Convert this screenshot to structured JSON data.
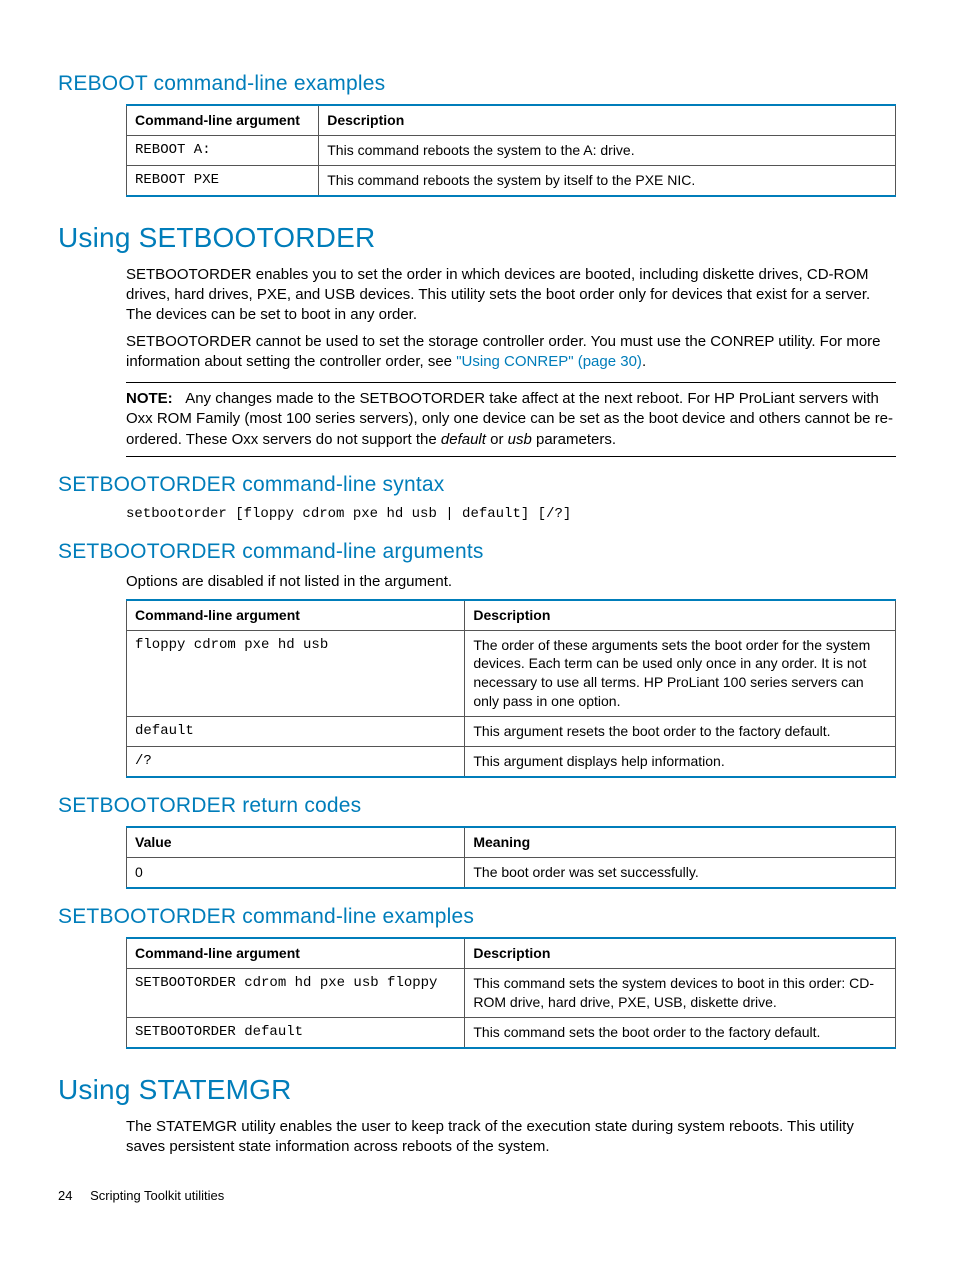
{
  "sections": {
    "reboot_examples_heading": "REBOOT command-line examples",
    "setbootorder_heading": "Using SETBOOTORDER",
    "setbootorder_p1": "SETBOOTORDER enables you to set the order in which devices are booted, including diskette drives, CD-ROM drives, hard drives, PXE, and USB devices. This utility sets the boot order only for devices that exist for a server. The devices can be set to boot in any order.",
    "setbootorder_p2a": "SETBOOTORDER cannot be used to set the storage controller order. You must use the CONREP utility. For more information about setting the controller order, see ",
    "setbootorder_p2_link": "\"Using CONREP\" (page 30)",
    "setbootorder_p2b": ".",
    "note_label": "NOTE:",
    "note_body_1": "Any changes made to the SETBOOTORDER take affect at the next reboot. For HP ProLiant servers with Oxx ROM Family (most 100 series servers), only one device can be set as the boot device and others cannot be re-ordered. These Oxx servers do not support the ",
    "note_i1": "default",
    "note_or": " or ",
    "note_i2": "usb",
    "note_body_2": " parameters.",
    "syntax_heading": "SETBOOTORDER command-line syntax",
    "syntax_code": "setbootorder [floppy cdrom pxe hd usb | default] [/?]",
    "args_heading": "SETBOOTORDER command-line arguments",
    "args_intro": "Options are disabled if not listed in the argument.",
    "returncodes_heading": "SETBOOTORDER return codes",
    "examples_heading": "SETBOOTORDER command-line examples",
    "statemgr_heading": "Using STATEMGR",
    "statemgr_p": "The STATEMGR utility enables the user to keep track of the execution state during system reboots. This utility saves persistent state information across reboots of the system."
  },
  "tables": {
    "reboot_examples": {
      "h1": "Command-line argument",
      "h2": "Description",
      "rows": [
        {
          "arg": "REBOOT A:",
          "desc": "This command reboots the system to the A: drive."
        },
        {
          "arg": "REBOOT PXE",
          "desc": "This command reboots the system by itself to the PXE NIC."
        }
      ]
    },
    "args": {
      "h1": "Command-line argument",
      "h2": "Description",
      "rows": [
        {
          "arg": "floppy cdrom pxe hd usb",
          "desc": "The order of these arguments sets the boot order for the system devices. Each term can be used only once in any order. It is not necessary to use all terms. HP ProLiant 100 series servers can only pass in one option."
        },
        {
          "arg": "default",
          "desc": "This argument resets the boot order to the factory default."
        },
        {
          "arg": "/?",
          "desc": "This argument displays help information."
        }
      ]
    },
    "returncodes": {
      "h1": "Value",
      "h2": "Meaning",
      "rows": [
        {
          "arg": "0",
          "desc": "The boot order was set successfully."
        }
      ]
    },
    "examples": {
      "h1": "Command-line argument",
      "h2": "Description",
      "rows": [
        {
          "arg": "SETBOOTORDER cdrom hd pxe usb floppy",
          "desc": "This command sets the system devices to boot in this order: CD-ROM drive, hard drive, PXE, USB, diskette drive."
        },
        {
          "arg": "SETBOOTORDER default",
          "desc": "This command sets the boot order to the factory default."
        }
      ]
    }
  },
  "footer": {
    "page": "24",
    "title": "Scripting Toolkit utilities"
  }
}
